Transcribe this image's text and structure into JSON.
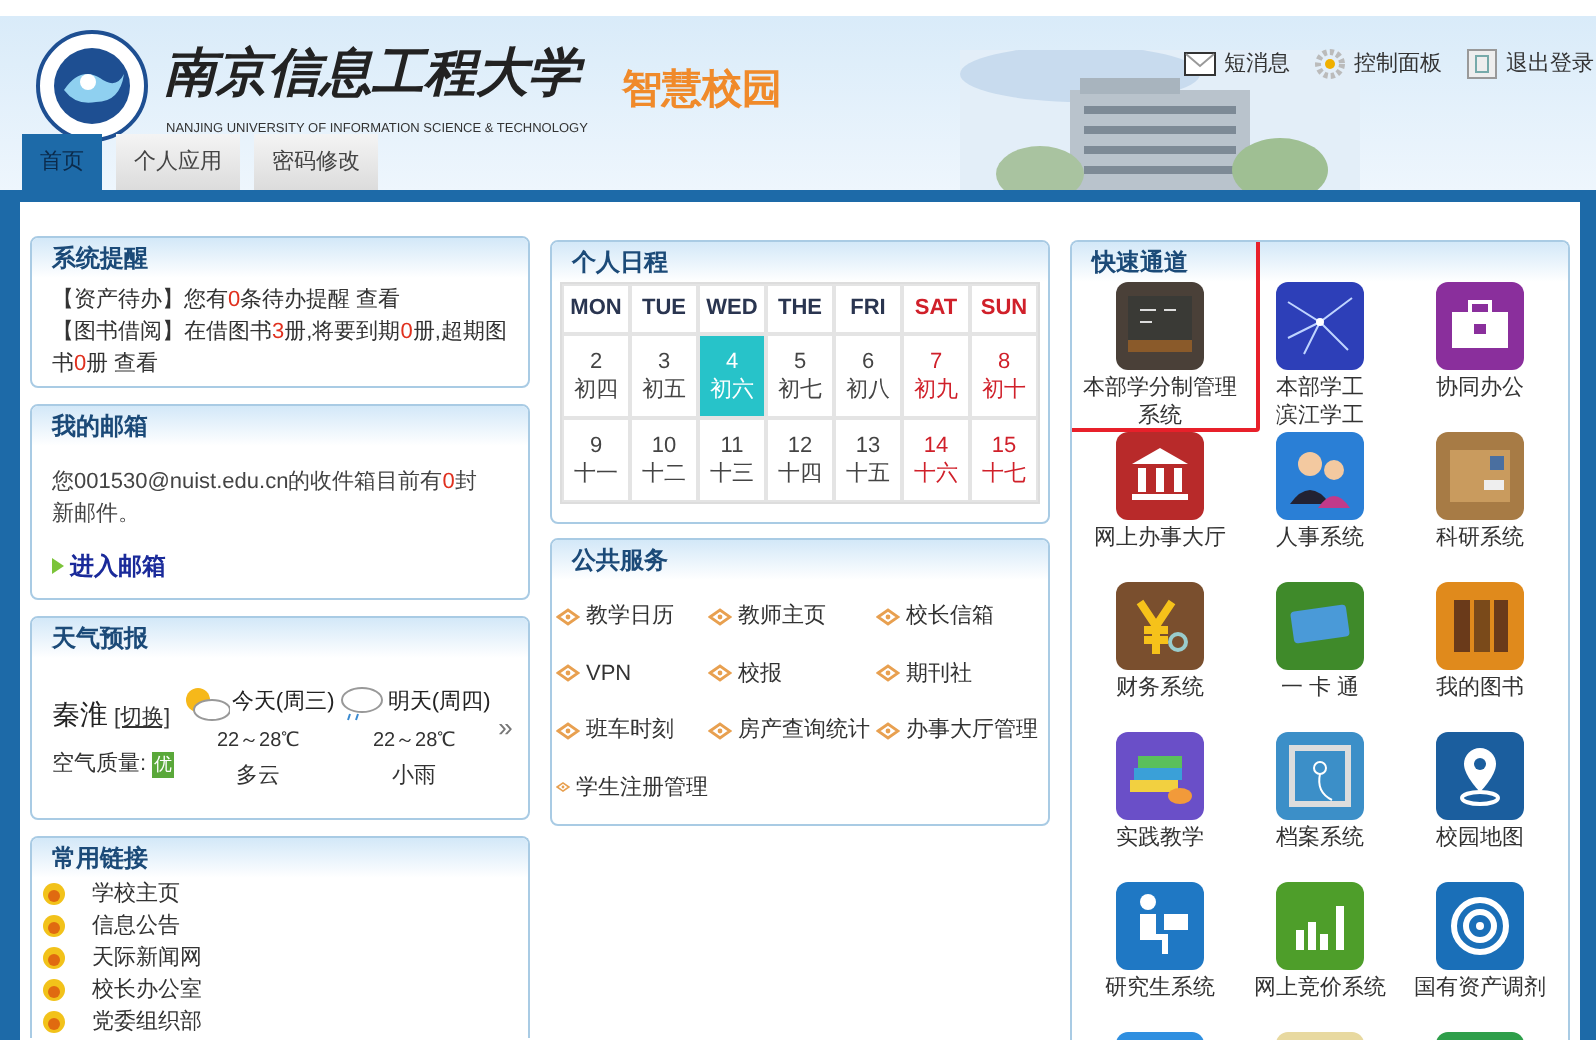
{
  "header": {
    "school_name": "南京信息工程大学",
    "school_name_en": "NANJING UNIVERSITY OF INFORMATION SCIENCE & TECHNOLOGY",
    "portal_name": "智慧校园",
    "actions": [
      {
        "label": "短消息",
        "kind": "mail"
      },
      {
        "label": "控制面板",
        "kind": "gear"
      },
      {
        "label": "退出登录",
        "kind": "exit"
      }
    ]
  },
  "tabs": [
    {
      "label": "首页",
      "selected": true
    },
    {
      "label": "个人应用",
      "selected": false
    },
    {
      "label": "密码修改",
      "selected": false
    }
  ],
  "system_reminder": {
    "title": "系统提醒",
    "lines": [
      {
        "parts": [
          {
            "text": "【资产待办】您有"
          },
          {
            "text": "0",
            "highlight": true
          },
          {
            "text": "条待办提醒 "
          }
        ],
        "link": "查看"
      },
      {
        "parts": [
          {
            "text": "【图书借阅】在借图书"
          },
          {
            "text": "3",
            "highlight": true
          },
          {
            "text": "册,将要到期"
          },
          {
            "text": "0",
            "highlight": true
          },
          {
            "text": "册,超期图书"
          },
          {
            "text": "0",
            "highlight": true
          },
          {
            "text": "册 "
          }
        ],
        "link": "查看"
      }
    ]
  },
  "mailbox": {
    "title": "我的邮箱",
    "parts": [
      {
        "text": "您001530@nuist.edu.cn的收件箱目前有"
      },
      {
        "text": "0",
        "highlight": true
      },
      {
        "text": "封新邮件。"
      }
    ],
    "link": "进入邮箱"
  },
  "weather": {
    "title": "天气预报",
    "city": "秦淮",
    "switch": "[切换]",
    "air_label": "空气质量:",
    "air_value": "优",
    "days": [
      {
        "day": "今天(周三)",
        "kind": "cloudy",
        "temp": "22～28℃",
        "desc": "多云"
      },
      {
        "day": "明天(周四)",
        "kind": "rain",
        "temp": "22～28℃",
        "desc": "小雨"
      }
    ],
    "more": "»"
  },
  "links": {
    "title": "常用链接",
    "items": [
      "学校主页",
      "信息公告",
      "天际新闻网",
      "校长办公室",
      "党委组织部"
    ]
  },
  "schedule": {
    "title": "个人日程",
    "days": [
      {
        "label": "MON",
        "weekend": false
      },
      {
        "label": "TUE",
        "weekend": false
      },
      {
        "label": "WED",
        "weekend": false
      },
      {
        "label": "THE",
        "weekend": false
      },
      {
        "label": "FRI",
        "weekend": false
      },
      {
        "label": "SAT",
        "weekend": true
      },
      {
        "label": "SUN",
        "weekend": true
      }
    ],
    "weeks": [
      [
        {
          "day": "2",
          "lunar": "初四",
          "selected": false
        },
        {
          "day": "3",
          "lunar": "初五",
          "selected": false
        },
        {
          "day": "4",
          "lunar": "初六",
          "selected": true
        },
        {
          "day": "5",
          "lunar": "初七",
          "selected": false
        },
        {
          "day": "6",
          "lunar": "初八",
          "selected": false
        },
        {
          "day": "7",
          "lunar": "初九",
          "selected": false
        },
        {
          "day": "8",
          "lunar": "初十",
          "selected": false
        }
      ],
      [
        {
          "day": "9",
          "lunar": "十一",
          "selected": false
        },
        {
          "day": "10",
          "lunar": "十二",
          "selected": false
        },
        {
          "day": "11",
          "lunar": "十三",
          "selected": false
        },
        {
          "day": "12",
          "lunar": "十四",
          "selected": false
        },
        {
          "day": "13",
          "lunar": "十五",
          "selected": false
        },
        {
          "day": "14",
          "lunar": "十六",
          "selected": false
        },
        {
          "day": "15",
          "lunar": "十七",
          "selected": false
        }
      ]
    ]
  },
  "public_services": {
    "title": "公共服务",
    "items": [
      "教学日历",
      "教师主页",
      "校长信箱",
      "VPN",
      "校报",
      "期刊社",
      "班车时刻",
      "房产查询统计",
      "办事大厅管理",
      "学生注册管理"
    ]
  },
  "quick_access": {
    "title": "快速通道",
    "items": [
      {
        "label": "本部学分制管理系统",
        "kind": "chalkboard",
        "color": "#4a4038",
        "highlighted": true
      },
      {
        "lines": [
          "本部学工",
          "滨江学工"
        ],
        "kind": "network",
        "color": "#2d3fb8",
        "highlighted": false
      },
      {
        "label": "协同办公",
        "kind": "briefcase",
        "color": "#8a2f9c",
        "highlighted": false
      },
      {
        "label": "网上办事大厅",
        "kind": "bank",
        "color": "#b82a2a",
        "highlighted": false
      },
      {
        "label": "人事系统",
        "kind": "people",
        "color": "#2a7fd6",
        "highlighted": false
      },
      {
        "label": "科研系统",
        "kind": "package",
        "color": "#a77b45",
        "highlighted": false
      },
      {
        "label": "财务系统",
        "kind": "yen",
        "color": "#7a4f2e",
        "highlighted": false
      },
      {
        "label": "一 卡 通",
        "kind": "card",
        "color": "#3f8a2a",
        "highlighted": false
      },
      {
        "label": "我的图书",
        "kind": "binders",
        "color": "#e08a1c",
        "highlighted": false
      },
      {
        "label": "实践教学",
        "kind": "books",
        "color": "#6a4fc8",
        "highlighted": false
      },
      {
        "label": "档案系统",
        "kind": "folder",
        "color": "#3c8fc8",
        "highlighted": false
      },
      {
        "label": "校园地图",
        "kind": "map-pin",
        "color": "#1b5e9e",
        "highlighted": false
      },
      {
        "label": "研究生系统",
        "kind": "student",
        "color": "#1f78c4",
        "highlighted": false
      },
      {
        "label": "网上竞价系统",
        "kind": "bar-chart",
        "color": "#4e9e2a",
        "highlighted": false
      },
      {
        "label": "国有资产调剂",
        "kind": "target",
        "color": "#1a6fb8",
        "highlighted": false
      },
      {
        "kind": "app",
        "color": "#2f8fe0",
        "highlighted": false
      },
      {
        "kind": "app",
        "color": "#e8d9a0",
        "highlighted": false
      },
      {
        "kind": "app",
        "color": "#2e9e4a",
        "highlighted": false
      }
    ]
  }
}
